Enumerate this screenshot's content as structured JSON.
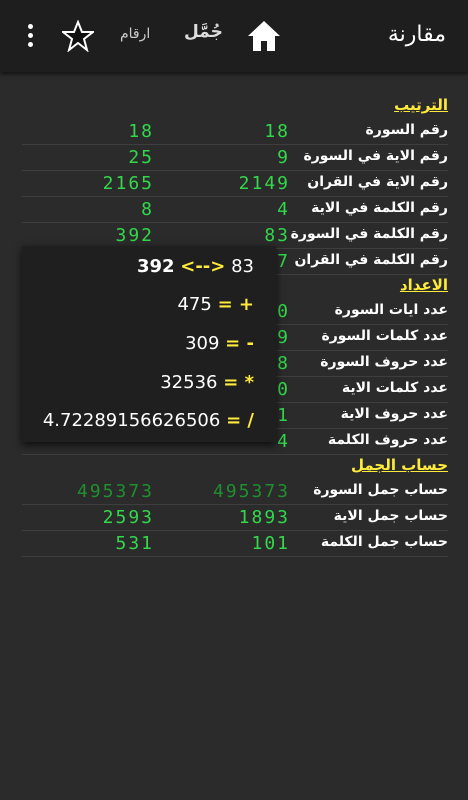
{
  "appbar": {
    "title": "مقارنة",
    "arqam_label": "ارقام",
    "jummal_label": "جُمَّل"
  },
  "sections": {
    "order": "الترتيب",
    "counts": "الاعداد",
    "jummal": "حساب الجمل"
  },
  "order_rows": [
    {
      "label": "رقم السورة",
      "v1": "18",
      "v2": "18"
    },
    {
      "label": "رقم الاية في السورة",
      "v1": "9",
      "v2": "25"
    },
    {
      "label": "رقم الاية في القران",
      "v1": "2149",
      "v2": "2165"
    },
    {
      "label": "رقم الكلمة في الاية",
      "v1": "4",
      "v2": "8"
    },
    {
      "label": "رقم الكلمة في السورة",
      "v1": "83",
      "v2": "392"
    },
    {
      "label": "رقم الكلمة في القران",
      "v1": "7",
      "v2": ""
    }
  ],
  "count_rows": [
    {
      "label": "عدد ايات السورة",
      "v1": "0",
      "v2": ""
    },
    {
      "label": "عدد كلمات السورة",
      "v1": "9",
      "v2": ""
    },
    {
      "label": "عدد حروف السورة",
      "v1": "8",
      "v2": ""
    },
    {
      "label": "عدد كلمات الاية",
      "v1": "0",
      "v2": ""
    },
    {
      "label": "عدد حروف الاية",
      "v1": "1",
      "v2": ""
    },
    {
      "label": "عدد حروف الكلمة",
      "v1": "4",
      "v2": ""
    }
  ],
  "jummal_rows": [
    {
      "label": "حساب جمل السورة",
      "v1": "495373",
      "v2": "495373"
    },
    {
      "label": "حساب جمل الاية",
      "v1": "1893",
      "v2": "2593"
    },
    {
      "label": "حساب جمل الكلمة",
      "v1": "101",
      "v2": "531"
    }
  ],
  "popup": {
    "compare": {
      "a": "83",
      "arrow": "<-->",
      "b": "392"
    },
    "sum": {
      "value": "475",
      "op": "= +"
    },
    "diff": {
      "value": "309",
      "op": "= -"
    },
    "product": {
      "value": "32536",
      "op": "= *"
    },
    "ratio": {
      "value": "4.72289156626506",
      "op": "= /"
    }
  }
}
